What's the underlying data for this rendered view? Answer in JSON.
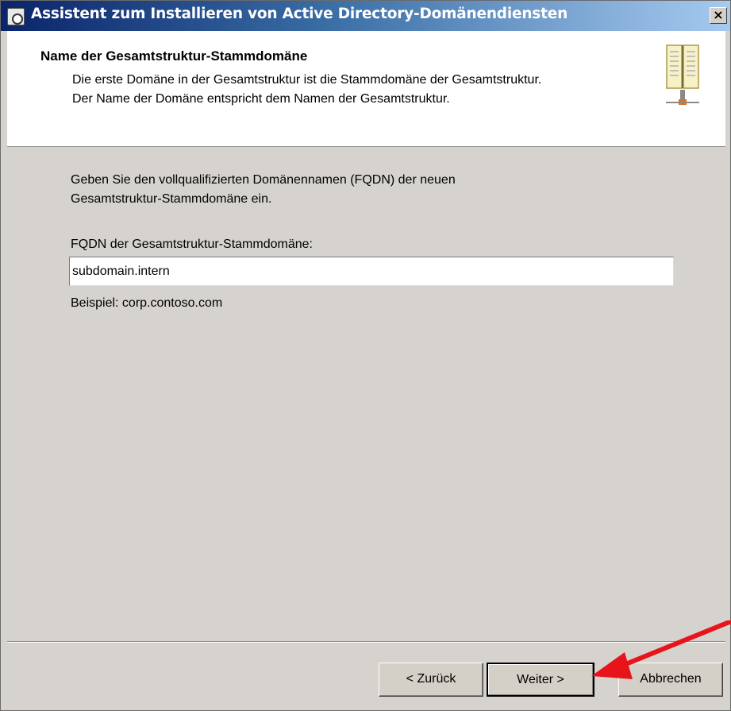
{
  "window": {
    "title": "Assistent zum Installieren von Active Directory-Domänendiensten",
    "close_label": "×"
  },
  "header": {
    "title": "Name der Gesamtstruktur-Stammdomäne",
    "desc_line1": "Die erste Domäne in der Gesamtstruktur ist die Stammdomäne der Gesamtstruktur.",
    "desc_line2": "Der Name der Domäne entspricht dem Namen der Gesamtstruktur.",
    "icon": "directory-book-icon"
  },
  "body": {
    "prompt_line1": "Geben Sie den vollqualifizierten Domänennamen (FQDN) der neuen",
    "prompt_line2": "Gesamtstruktur-Stammdomäne ein.",
    "fqdn_label": "FQDN der Gesamtstruktur-Stammdomäne:",
    "fqdn_value": "subdomain.intern",
    "example": "Beispiel: corp.contoso.com"
  },
  "buttons": {
    "back": "< Zurück",
    "next": "Weiter >",
    "cancel": "Abbrechen"
  },
  "colors": {
    "annotation_arrow": "#e8141c",
    "titlebar_start": "#0a246a",
    "titlebar_end": "#a6caf0",
    "dialog_bg": "#d6d3ce"
  }
}
